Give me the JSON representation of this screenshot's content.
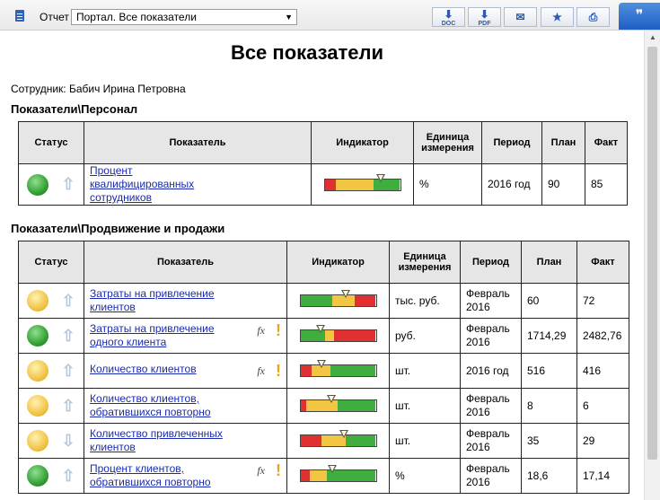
{
  "toolbar": {
    "report_label": "Отчет",
    "report_select": "Портал. Все показатели",
    "buttons": [
      {
        "label": "DOC",
        "icon": "doc-export-icon"
      },
      {
        "label": "PDF",
        "icon": "pdf-export-icon"
      },
      {
        "label": "",
        "icon": "email-icon"
      },
      {
        "label": "",
        "icon": "star-icon"
      },
      {
        "label": "",
        "icon": "print-icon"
      }
    ]
  },
  "page": {
    "title": "Все показатели",
    "employee": "Сотрудник: Бабич Ирина Петровна"
  },
  "columns": {
    "status": "Статус",
    "indicator_name": "Показатель",
    "indicator": "Индикатор",
    "unit": "Единица измерения",
    "period": "Период",
    "plan": "План",
    "fact": "Факт"
  },
  "sections": [
    {
      "title": "Показатели\\Персонал",
      "rows": [
        {
          "status": "green",
          "trend": "up",
          "name": "Процент квалифицированных сотрудников",
          "fx": false,
          "warn": false,
          "indicator": {
            "segments": [
              "red",
              "yellow",
              "green"
            ],
            "splits": [
              0.15,
              0.65
            ],
            "marker": 0.74
          },
          "unit": "%",
          "period": "2016 год",
          "plan": "90",
          "fact": "85"
        }
      ]
    },
    {
      "title": "Показатели\\Продвижение и продажи",
      "rows": [
        {
          "status": "yellow",
          "trend": "up",
          "name": "Затраты на привлечение клиентов",
          "fx": false,
          "warn": false,
          "indicator": {
            "segments": [
              "green",
              "yellow",
              "red"
            ],
            "splits": [
              0.42,
              0.72
            ],
            "marker": 0.6
          },
          "unit": "тыс. руб.",
          "period": "Февраль 2016",
          "plan": "60",
          "fact": "72"
        },
        {
          "status": "green",
          "trend": "up",
          "name": "Затраты на привлечение одного клиента",
          "fx": true,
          "warn": true,
          "indicator": {
            "segments": [
              "green",
              "yellow",
              "red"
            ],
            "splits": [
              0.33,
              0.45
            ],
            "marker": 0.27
          },
          "unit": "руб.",
          "period": "Февраль 2016",
          "plan": "1714,29",
          "fact": "2482,76"
        },
        {
          "status": "yellow",
          "trend": "up",
          "name": "Количество клиентов",
          "fx": true,
          "warn": true,
          "indicator": {
            "segments": [
              "red",
              "yellow",
              "green"
            ],
            "splits": [
              0.15,
              0.4
            ],
            "marker": 0.28
          },
          "unit": "шт.",
          "period": "2016 год",
          "plan": "516",
          "fact": "416"
        },
        {
          "status": "yellow",
          "trend": "up",
          "name": "Количество клиентов, обратившихся повторно",
          "fx": false,
          "warn": false,
          "indicator": {
            "segments": [
              "red",
              "yellow",
              "green"
            ],
            "splits": [
              0.08,
              0.5
            ],
            "marker": 0.41
          },
          "unit": "шт.",
          "period": "Февраль 2016",
          "plan": "8",
          "fact": "6"
        },
        {
          "status": "yellow",
          "trend": "down",
          "name": "Количество привлеченных клиентов",
          "fx": false,
          "warn": false,
          "indicator": {
            "segments": [
              "red",
              "yellow",
              "green"
            ],
            "splits": [
              0.28,
              0.6
            ],
            "marker": 0.58
          },
          "unit": "шт.",
          "period": "Февраль 2016",
          "plan": "35",
          "fact": "29"
        },
        {
          "status": "green",
          "trend": "up",
          "name": "Процент клиентов, обратившихся повторно",
          "fx": true,
          "warn": true,
          "indicator": {
            "segments": [
              "red",
              "yellow",
              "green"
            ],
            "splits": [
              0.12,
              0.35
            ],
            "marker": 0.42
          },
          "unit": "%",
          "period": "Февраль 2016",
          "plan": "18,6",
          "fact": "17,14"
        }
      ]
    }
  ],
  "colors": {
    "red": "#e03030",
    "yellow": "#f2c542",
    "green": "#3fae3f",
    "accent": "#2a5bb4"
  },
  "chat_icon": "chat-bubbles-icon"
}
